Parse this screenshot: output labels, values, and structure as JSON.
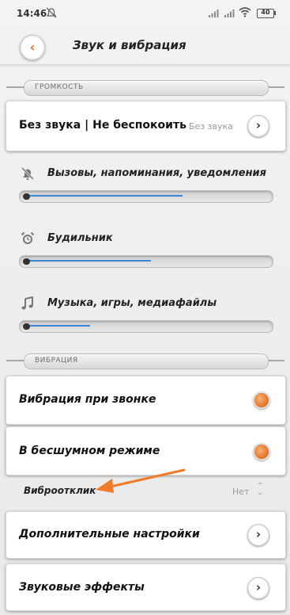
{
  "status_bar": {
    "time": "14:46",
    "battery": "40"
  },
  "header": {
    "title": "Звук и вибрация"
  },
  "sections": {
    "volume": "ГРОМКОСТЬ",
    "vibration": "ВИБРАЦИЯ"
  },
  "silent_mode": {
    "label": "Без звука | Не беспокоить",
    "value": "Без звука"
  },
  "volume": [
    {
      "label": "Вызовы, напоминания, уведомления",
      "level": 0.65,
      "icon": "bell-off-icon"
    },
    {
      "label": "Будильник",
      "level": 0.52,
      "icon": "alarm-clock-icon"
    },
    {
      "label": "Музыка, игры, медиафайлы",
      "level": 0.27,
      "icon": "music-note-icon"
    }
  ],
  "vibration": [
    {
      "label": "Вибрация при звонке",
      "on": true
    },
    {
      "label": "В бесшумном режиме",
      "on": true
    }
  ],
  "haptic": {
    "label": "Виброотклик",
    "value": "Нет"
  },
  "more": [
    {
      "label": "Дополнительные настройки"
    },
    {
      "label": "Звуковые эффекты"
    }
  ],
  "colors": {
    "accent": "#e06a2b",
    "slider_fill": "#3a86d6",
    "annotation_arrow": "#f07b2a"
  }
}
